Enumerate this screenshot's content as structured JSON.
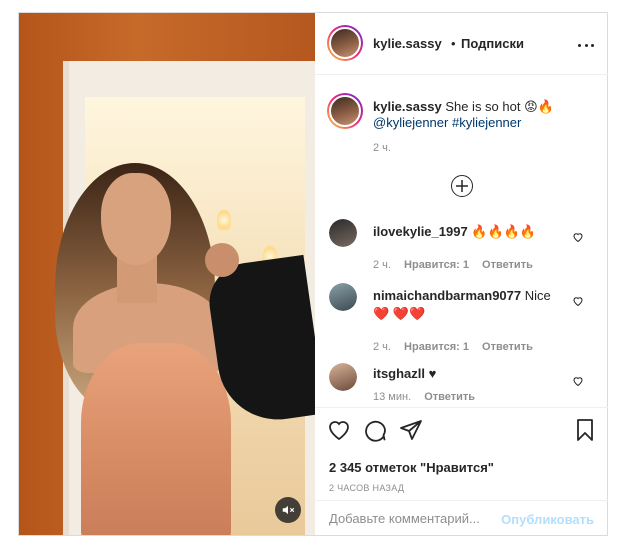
{
  "post": {
    "username": "kylie.sassy",
    "separator": "•",
    "follow_label": "Подписки",
    "caption_user": "kylie.sassy",
    "caption_text": "She is so hot 😡🔥",
    "caption_tags": [
      "@kyliejenner",
      "#kyliejenner"
    ],
    "caption_time": "2 ч."
  },
  "comments": [
    {
      "user": "ilovekylie_1997",
      "text": "🔥🔥🔥🔥",
      "time": "2 ч.",
      "likes": "Нравится: 1",
      "reply": "Ответить"
    },
    {
      "user": "nimaichandbarman9077",
      "text": "Nice ❤️ ❤️❤️",
      "time": "2 ч.",
      "likes": "Нравится: 1",
      "reply": "Ответить"
    },
    {
      "user": "itsghazll",
      "text": "♥",
      "time": "13 мин.",
      "likes": "",
      "reply": "Ответить"
    }
  ],
  "footer": {
    "likes_count": "2 345 отметок \"Нравится\"",
    "posted_ago": "2 часов назад",
    "comment_placeholder": "Добавьте комментарий...",
    "publish_label": "Опубликовать"
  },
  "icons": {
    "like": "heart-icon",
    "comment": "comment-icon",
    "share": "share-icon",
    "save": "bookmark-icon",
    "more": "more-options-icon",
    "mute": "mute-icon",
    "load_more": "plus-circle-icon"
  },
  "colors": {
    "text": "#262626",
    "muted": "#8e8e8e",
    "link": "#00376b",
    "publish_disabled": "#b2dffc",
    "heart_red": "#ed4956"
  }
}
